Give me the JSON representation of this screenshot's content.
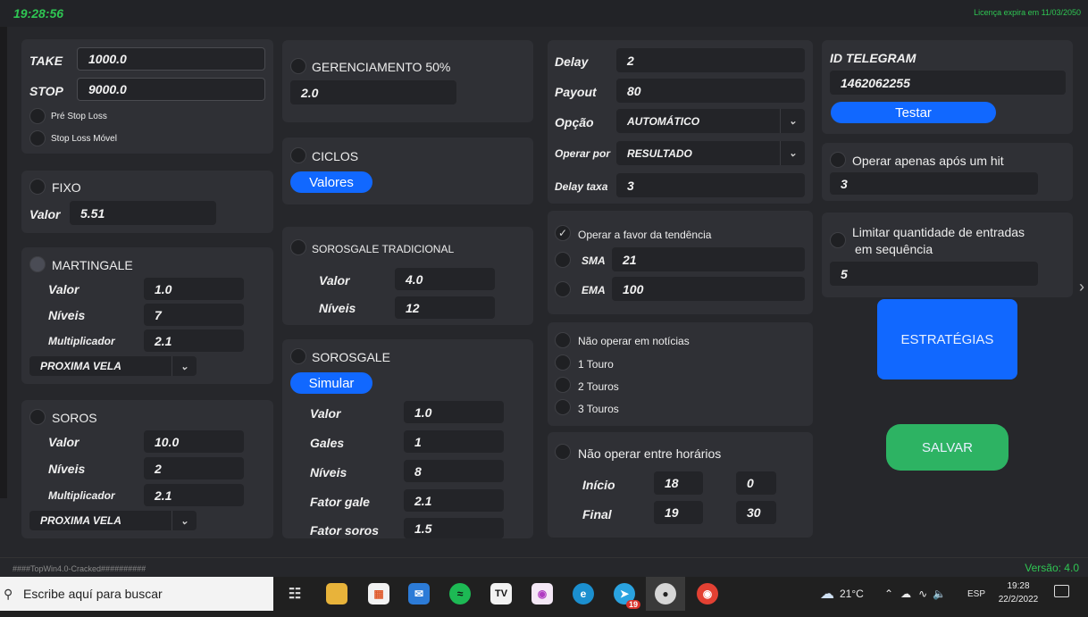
{
  "header": {
    "time": "19:28:56",
    "license": "Licença expira em 11/03/2050"
  },
  "take_stop": {
    "take_label": "TAKE",
    "take_value": "1000.0",
    "stop_label": "STOP",
    "stop_value": "9000.0",
    "pre_stop_loss": "Pré Stop Loss",
    "stop_loss_movel": "Stop Loss Móvel"
  },
  "fixo": {
    "title": "FIXO",
    "valor_label": "Valor",
    "valor": "5.51"
  },
  "martingale": {
    "title": "MARTINGALE",
    "valor_label": "Valor",
    "valor": "1.0",
    "niveis_label": "Níveis",
    "niveis": "7",
    "mult_label": "Multiplicador",
    "mult": "2.1",
    "mode": "PROXIMA VELA"
  },
  "soros": {
    "title": "SOROS",
    "valor_label": "Valor",
    "valor": "10.0",
    "niveis_label": "Níveis",
    "niveis": "2",
    "mult_label": "Multiplicador",
    "mult": "2.1",
    "mode": "PROXIMA VELA"
  },
  "gerenciamento": {
    "title": "GERENCIAMENTO 50%",
    "value": "2.0"
  },
  "ciclos": {
    "title": "CICLOS",
    "button": "Valores"
  },
  "sorosgale_trad": {
    "title": "SOROSGALE TRADICIONAL",
    "valor_label": "Valor",
    "valor": "4.0",
    "niveis_label": "Níveis",
    "niveis": "12"
  },
  "sorosgale": {
    "title": "SOROSGALE",
    "button": "Simular",
    "valor_label": "Valor",
    "valor": "1.0",
    "gales_label": "Gales",
    "gales": "1",
    "niveis_label": "Níveis",
    "niveis": "8",
    "fator_gale_label": "Fator gale",
    "fator_gale": "2.1",
    "fator_soros_label": "Fator soros",
    "fator_soros": "1.5"
  },
  "config": {
    "delay_label": "Delay",
    "delay": "2",
    "payout_label": "Payout",
    "payout": "80",
    "opcao_label": "Opção",
    "opcao": "AUTOMÁTICO",
    "operar_por_label": "Operar por",
    "operar_por": "RESULTADO",
    "delay_taxa_label": "Delay taxa",
    "delay_taxa": "3"
  },
  "tendencia": {
    "title": "Operar a favor da tendência",
    "sma_label": "SMA",
    "sma": "21",
    "ema_label": "EMA",
    "ema": "100"
  },
  "noticias": {
    "title": "Não operar em notícias",
    "t1": "1 Touro",
    "t2": "2 Touros",
    "t3": "3 Touros"
  },
  "horarios": {
    "title": "Não operar entre horários",
    "inicio_label": "Início",
    "inicio_h": "18",
    "inicio_m": "0",
    "final_label": "Final",
    "final_h": "19",
    "final_m": "30"
  },
  "telegram": {
    "title": "ID TELEGRAM",
    "id": "1462062255",
    "button": "Testar"
  },
  "hit": {
    "title": "Operar apenas após um hit",
    "value": "3"
  },
  "limitar": {
    "title_line1": "Limitar quantidade de entradas",
    "title_line2": "em sequência",
    "value": "5"
  },
  "buttons": {
    "estrategias": "ESTRATÉGIAS",
    "salvar": "SALVAR"
  },
  "status": {
    "watermark": "####TopWin4.0-Cracked##########",
    "version": "Versão: 4.0"
  },
  "taskbar": {
    "search_placeholder": "Escribe aquí para buscar",
    "weather": "21°C",
    "lang": "ESP",
    "time": "19:28",
    "date": "22/2/2022",
    "badge": "19"
  }
}
